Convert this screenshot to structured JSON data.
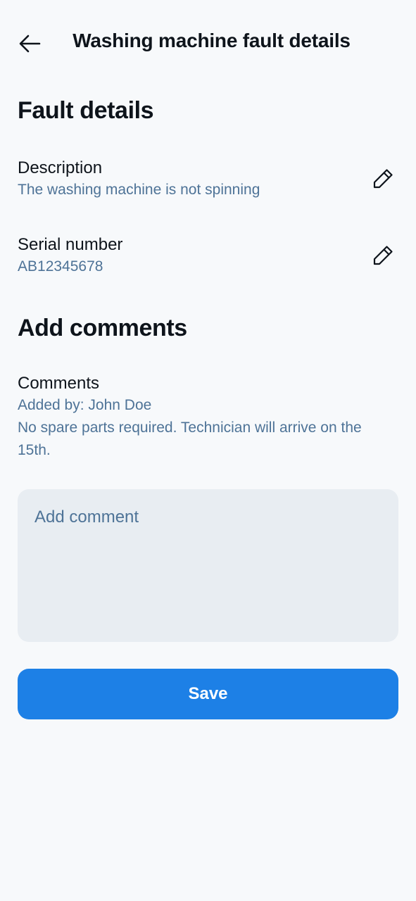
{
  "header": {
    "title": "Washing machine fault details",
    "back_icon": "arrow-left-icon"
  },
  "fault_details": {
    "heading": "Fault details",
    "description": {
      "label": "Description",
      "value": "The washing machine is not spinning",
      "edit_icon": "pencil-icon"
    },
    "serial": {
      "label": "Serial number",
      "value": "AB12345678",
      "edit_icon": "pencil-icon"
    }
  },
  "add_comments": {
    "heading": "Add comments",
    "comments_label": "Comments",
    "added_by": "Added by: John Doe",
    "comment_text": "No spare parts required. Technician will arrive on the 15th.",
    "input_placeholder": "Add comment",
    "input_value": ""
  },
  "actions": {
    "save_label": "Save"
  },
  "colors": {
    "background": "#f7f9fb",
    "primary_text": "#0e141b",
    "secondary_text": "#4e7397",
    "input_bg": "#e8edf2",
    "accent": "#1d80e6"
  }
}
